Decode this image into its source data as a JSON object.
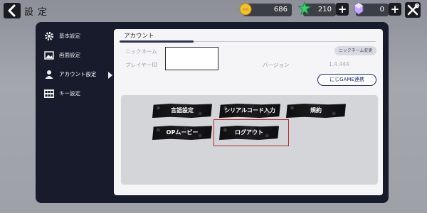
{
  "header": {
    "title": "設定",
    "coins": "686",
    "gems": "210",
    "crystals": "0",
    "plus_symbol": "+"
  },
  "sidebar": {
    "items": [
      {
        "label": "基本設定",
        "icon": "gear-icon"
      },
      {
        "label": "画面設定",
        "icon": "image-icon"
      },
      {
        "label": "アカウント設定",
        "icon": "person-icon",
        "active": true
      },
      {
        "label": "キー設定",
        "icon": "keyboard-icon"
      }
    ]
  },
  "account": {
    "section_title": "アカウント",
    "nickname_label": "ニックネーム",
    "nickname_change_button": "ニックネーム変更",
    "player_id_label": "プレイヤーID",
    "version_label": "バージョン",
    "version_value": "1.4.444",
    "link_button": "にじGAME連携"
  },
  "actions": {
    "language": "言語設定",
    "serial_code": "シリアルコード入力",
    "terms": "規約",
    "op_movie": "OPムービー",
    "logout": "ログアウト"
  },
  "colors": {
    "panel": "#171b2c",
    "card": "#f5f5f7",
    "accent_blue": "#1c2a6a",
    "highlight_red": "#b02a2a"
  }
}
